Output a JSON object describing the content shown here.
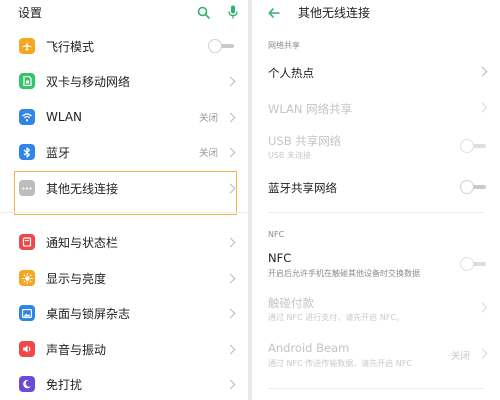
{
  "left": {
    "title": "设置",
    "items": [
      {
        "label": "飞行模式",
        "icon": "airplane-icon",
        "color": "#f5a623",
        "control": "toggle"
      },
      {
        "label": "双卡与移动网络",
        "icon": "sim-card-icon",
        "color": "#34c46a",
        "control": "chevron"
      },
      {
        "label": "WLAN",
        "icon": "wifi-icon",
        "color": "#2f86e8",
        "value": "关闭",
        "control": "chevron"
      },
      {
        "label": "蓝牙",
        "icon": "bluetooth-icon",
        "color": "#2f86e8",
        "value": "关闭",
        "control": "chevron"
      },
      {
        "label": "其他无线连接",
        "icon": "more-dots-icon",
        "color": "#bdbdbd",
        "control": "chevron"
      },
      {
        "label": "通知与状态栏",
        "icon": "notification-icon",
        "color": "#f04848",
        "control": "chevron"
      },
      {
        "label": "显示与亮度",
        "icon": "brightness-icon",
        "color": "#f5a623",
        "control": "chevron"
      },
      {
        "label": "桌面与锁屏杂志",
        "icon": "wallpaper-icon",
        "color": "#2f86e8",
        "control": "chevron"
      },
      {
        "label": "声音与振动",
        "icon": "speaker-icon",
        "color": "#f04848",
        "control": "chevron"
      },
      {
        "label": "免打扰",
        "icon": "moon-icon",
        "color": "#6a4bd8",
        "control": "chevron"
      }
    ]
  },
  "right": {
    "title": "其他无线连接",
    "section_share": "网络共享",
    "hotspot": "个人热点",
    "wlan_share": "WLAN 网络共享",
    "usb_share": "USB 共享网络",
    "usb_share_sub": "USB 未连接",
    "bt_share": "蓝牙共享网络",
    "section_nfc": "NFC",
    "nfc": "NFC",
    "nfc_sub": "开启后允许手机在触碰其他设备时交换数据",
    "touch_pay": "触碰付款",
    "touch_pay_sub": "通过 NFC 进行支付，请先开启 NFC。",
    "android_beam": "Android Beam",
    "android_beam_sub": "通过 NFC 传送传输数据，请先开启 NFC",
    "android_beam_value": "关闭"
  },
  "colors": {
    "accent": "#2db36b",
    "highlight": "#f0b44c"
  }
}
